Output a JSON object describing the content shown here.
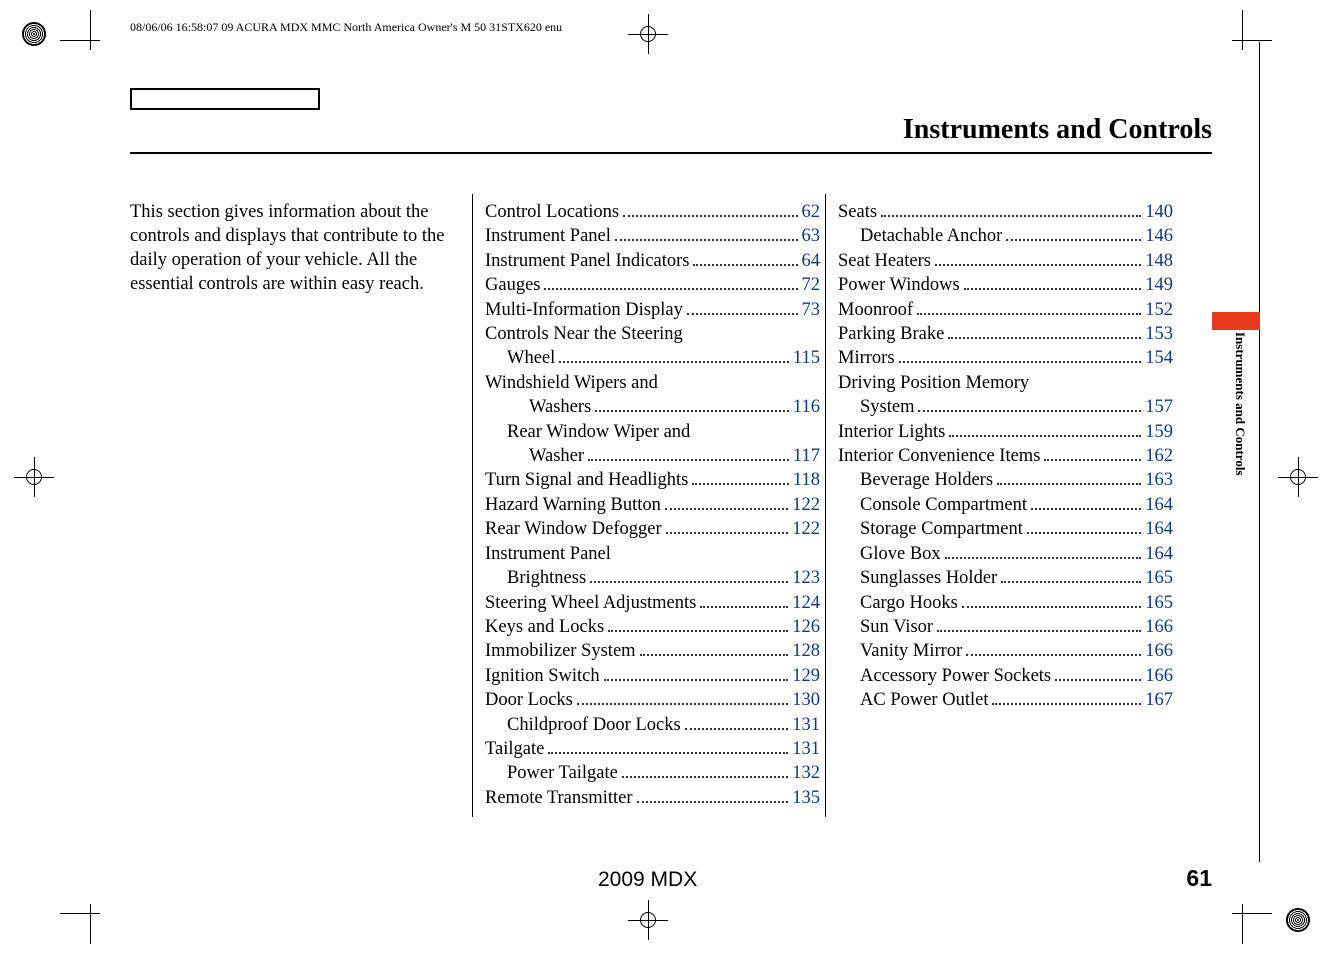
{
  "header_text": "08/06/06 16:58:07    09 ACURA MDX MMC North America Owner's M 50 31STX620 enu",
  "page_title": "Instruments and Controls",
  "intro": "This section gives information about the controls and displays that contribute to the daily operation of your vehicle. All the essential controls are within easy reach.",
  "toc_col2": [
    {
      "label": "Control Locations",
      "page": "62",
      "indent": 0
    },
    {
      "label": "Instrument Panel",
      "page": "63",
      "indent": 0
    },
    {
      "label": "Instrument Panel Indicators",
      "page": "64",
      "indent": 0
    },
    {
      "label": "Gauges",
      "page": "72",
      "indent": 0
    },
    {
      "label": "Multi-Information Display",
      "page": "73",
      "indent": 0
    },
    {
      "label": "Controls Near the Steering",
      "indent": 0,
      "cont": true
    },
    {
      "label": "Wheel",
      "page": "115",
      "indent": 1
    },
    {
      "label": "Windshield Wipers and",
      "indent": 0,
      "cont": true
    },
    {
      "label": "Washers",
      "page": "116",
      "indent": 2
    },
    {
      "label": "Rear Window Wiper and",
      "indent": 1,
      "cont": true
    },
    {
      "label": "Washer",
      "page": "117",
      "indent": 2
    },
    {
      "label": "Turn Signal and Headlights",
      "page": "118",
      "indent": 0
    },
    {
      "label": "Hazard Warning Button",
      "page": "122",
      "indent": 0
    },
    {
      "label": "Rear Window Defogger",
      "page": "122",
      "indent": 0
    },
    {
      "label": "Instrument Panel",
      "indent": 0,
      "cont": true
    },
    {
      "label": "Brightness",
      "page": "123",
      "indent": 1
    },
    {
      "label": "Steering Wheel Adjustments",
      "page": "124",
      "indent": 0
    },
    {
      "label": "Keys and Locks",
      "page": "126",
      "indent": 0
    },
    {
      "label": "Immobilizer System",
      "page": "128",
      "indent": 0
    },
    {
      "label": "Ignition Switch",
      "page": "129",
      "indent": 0
    },
    {
      "label": "Door Locks",
      "page": "130",
      "indent": 0
    },
    {
      "label": "Childproof Door Locks",
      "page": "131",
      "indent": 1
    },
    {
      "label": "Tailgate",
      "page": "131",
      "indent": 0
    },
    {
      "label": "Power Tailgate",
      "page": "132",
      "indent": 1
    },
    {
      "label": "Remote Transmitter",
      "page": "135",
      "indent": 0
    }
  ],
  "toc_col3": [
    {
      "label": "Seats",
      "page": "140",
      "indent": 0
    },
    {
      "label": "Detachable Anchor",
      "page": "146",
      "indent": 1
    },
    {
      "label": "Seat Heaters",
      "page": "148",
      "indent": 0
    },
    {
      "label": "Power Windows",
      "page": "149",
      "indent": 0
    },
    {
      "label": "Moonroof",
      "page": "152",
      "indent": 0
    },
    {
      "label": "Parking Brake",
      "page": "153",
      "indent": 0
    },
    {
      "label": "Mirrors",
      "page": "154",
      "indent": 0
    },
    {
      "label": "Driving Position Memory",
      "indent": 0,
      "cont": true
    },
    {
      "label": "System",
      "page": "157",
      "indent": 1
    },
    {
      "label": "Interior Lights",
      "page": "159",
      "indent": 0
    },
    {
      "label": "Interior Convenience Items",
      "page": "162",
      "indent": 0
    },
    {
      "label": "Beverage Holders",
      "page": "163",
      "indent": 1
    },
    {
      "label": "Console Compartment",
      "page": "164",
      "indent": 1
    },
    {
      "label": "Storage Compartment",
      "page": "164",
      "indent": 1
    },
    {
      "label": "Glove Box",
      "page": "164",
      "indent": 1
    },
    {
      "label": "Sunglasses Holder",
      "page": "165",
      "indent": 1
    },
    {
      "label": "Cargo Hooks",
      "page": "165",
      "indent": 1
    },
    {
      "label": "Sun Visor",
      "page": "166",
      "indent": 1
    },
    {
      "label": "Vanity Mirror",
      "page": "166",
      "indent": 1
    },
    {
      "label": "Accessory Power Sockets",
      "page": "166",
      "indent": 1
    },
    {
      "label": "AC Power Outlet",
      "page": "167",
      "indent": 1
    }
  ],
  "footer_model": "2009  MDX",
  "page_number": "61",
  "side_tab": "Instruments and Controls"
}
